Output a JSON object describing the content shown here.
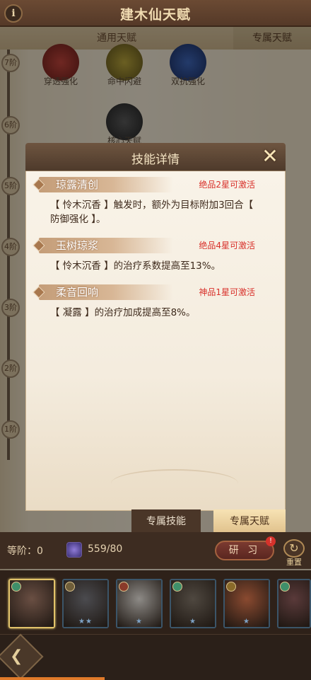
{
  "header": {
    "title": "建木仙天赋",
    "info_icon": "info-icon"
  },
  "tabs": {
    "general": "通用天赋",
    "exclusive": "专属天赋"
  },
  "tree": {
    "tiers": [
      "7阶",
      "6阶",
      "5阶",
      "4阶",
      "3阶",
      "2阶",
      "1阶"
    ],
    "nodes": [
      {
        "label": "穿透强化",
        "color": "#9b2f2a"
      },
      {
        "label": "命中闪避",
        "color": "#8a7a2a"
      },
      {
        "label": "双抗强化",
        "color": "#2a4a8a"
      },
      {
        "label": "核心天赋",
        "color": "#3b3b3b"
      }
    ]
  },
  "modal": {
    "title": "技能详情",
    "close_icon": "close-icon",
    "entries": [
      {
        "name": "琼露清创",
        "condition": "绝品2星可激活",
        "desc": "【 怜木沉香 】触发时，额外为目标附加3回合【 防御强化 】。"
      },
      {
        "name": "玉树琼浆",
        "condition": "绝品4星可激活",
        "desc": "【 怜木沉香 】的治疗系数提高至13%。"
      },
      {
        "name": "柔音回响",
        "condition": "神品1星可激活",
        "desc": "【 凝露 】的治疗加成提高至8%。"
      }
    ]
  },
  "bottom_tabs": {
    "skill": "专属技能",
    "talent": "专属天赋"
  },
  "info": {
    "level_label": "等阶：",
    "level_value": "0",
    "points": "559/80",
    "study_label": "研 习",
    "badge": "!",
    "reset_label": "重置"
  },
  "heroes": [
    {
      "color": "#6a4f43",
      "elem": "#3f8f6a",
      "stars": "",
      "selected": true
    },
    {
      "color": "#4b4b4f",
      "elem": "#6f5e3a",
      "stars": "★★",
      "selected": false
    },
    {
      "color": "#8d8a86",
      "elem": "#8a3b2a",
      "stars": "★",
      "selected": false
    },
    {
      "color": "#4f4840",
      "elem": "#3f8f6a",
      "stars": "★",
      "selected": false
    },
    {
      "color": "#8a4a30",
      "elem": "#8a6a2a",
      "stars": "★",
      "selected": false
    },
    {
      "color": "#5a3a3a",
      "elem": "#3f8f6a",
      "stars": "",
      "selected": false
    }
  ]
}
